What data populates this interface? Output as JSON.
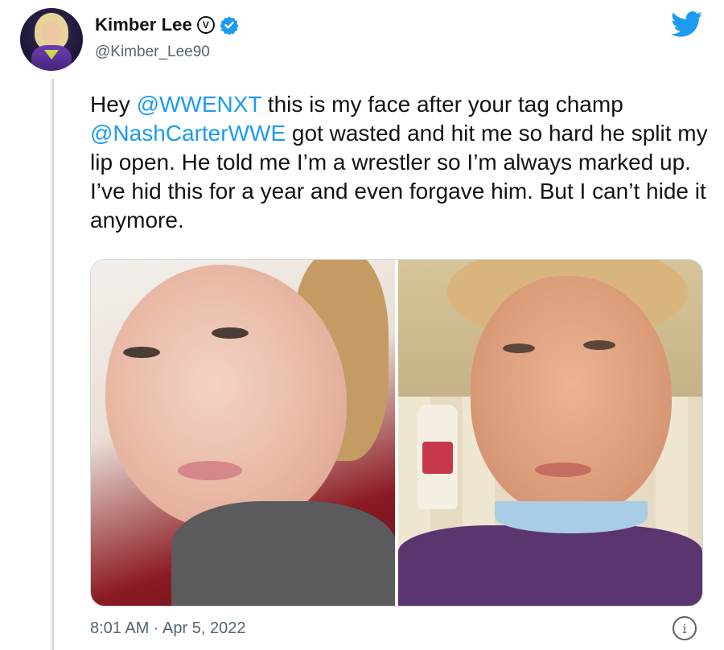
{
  "author": {
    "display_name": "Kimber Lee",
    "handle": "@Kimber_Lee90",
    "badge_letter": "V",
    "verified": true,
    "avatar_icon": "profile-photo"
  },
  "tweet": {
    "segments": [
      {
        "text": "Hey ",
        "type": "text"
      },
      {
        "text": "@WWENXT",
        "type": "mention"
      },
      {
        "text": " this is my face after your tag champ ",
        "type": "text"
      },
      {
        "text": "@NashCarterWWE",
        "type": "mention"
      },
      {
        "text": " got wasted and hit me so hard he split my lip open. He told me I’m a wrestler so I’m always marked up. I’ve hid this for a year and even forgave him. But I can’t hide it anymore.",
        "type": "text"
      }
    ],
    "media_count": 2,
    "timestamp": "8:01 AM · Apr 5, 2022"
  },
  "icons": {
    "brand": "twitter-bird-icon",
    "info": "info-icon"
  },
  "colors": {
    "mention": "#1d9bf0",
    "brand": "#1d9bf0",
    "text": "#0f1419",
    "secondary": "#536471"
  }
}
